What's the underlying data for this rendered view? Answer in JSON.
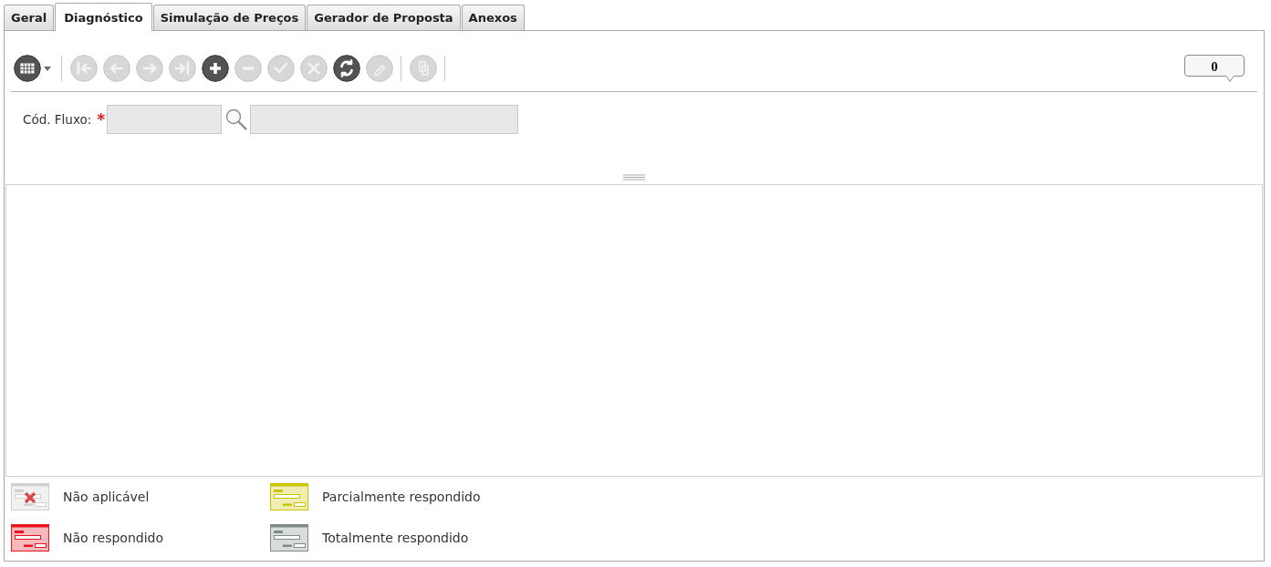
{
  "tabs": [
    {
      "label": "Geral",
      "selected": false
    },
    {
      "label": "Diagnóstico",
      "selected": true
    },
    {
      "label": "Simulação de Preços",
      "selected": false
    },
    {
      "label": "Gerador de Proposta",
      "selected": false
    },
    {
      "label": "Anexos",
      "selected": false
    }
  ],
  "toolbar": {
    "groups": [
      {
        "items": [
          {
            "kind": "grid_menu",
            "disabled": false
          }
        ]
      },
      {
        "items": [
          {
            "kind": "first",
            "disabled": true
          },
          {
            "kind": "previous",
            "disabled": true
          },
          {
            "kind": "next",
            "disabled": true
          },
          {
            "kind": "last",
            "disabled": true
          },
          {
            "kind": "add",
            "disabled": false
          },
          {
            "kind": "remove",
            "disabled": true
          },
          {
            "kind": "confirm",
            "disabled": true
          },
          {
            "kind": "cancel",
            "disabled": true
          },
          {
            "kind": "refresh",
            "disabled": false
          },
          {
            "kind": "edit",
            "disabled": true
          }
        ]
      },
      {
        "items": [
          {
            "kind": "copy",
            "disabled": true
          }
        ]
      }
    ],
    "record_count": "0"
  },
  "form": {
    "label": "Cód. Fluxo:",
    "required_mark": "*",
    "code_field": {
      "disabled": true
    },
    "description_field": {
      "disabled": true
    }
  },
  "legend": {
    "items": [
      {
        "label": "Não aplicável",
        "kind": "crossed",
        "color": "#d0d0d0"
      },
      {
        "label": "Parcialmente respondido",
        "kind": "plain",
        "color": "#c8c400"
      },
      {
        "label": "Não respondido",
        "kind": "plain",
        "color": "#e8141e"
      },
      {
        "label": "Totalmente respondido",
        "kind": "plain",
        "color": "#7d8c84"
      }
    ]
  }
}
